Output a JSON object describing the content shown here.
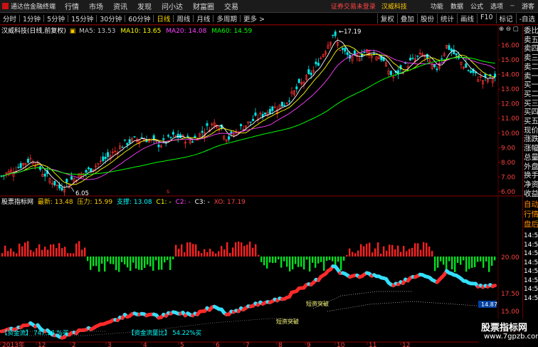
{
  "app": {
    "title": "通达信金融终端",
    "warning": "证券交易未登录",
    "stock_name": "汉威科技"
  },
  "menu": [
    "行情",
    "市场",
    "资讯",
    "发现",
    "问小达",
    "财富圈",
    "交易"
  ],
  "right_menu": [
    "功能",
    "数据",
    "公式",
    "选项"
  ],
  "guest": "游客",
  "periods": [
    "分时",
    "1分钟",
    "5分钟",
    "15分钟",
    "30分钟",
    "60分钟",
    "日线",
    "周线",
    "月线",
    "多周期",
    "更多 >"
  ],
  "active_period": "日线",
  "toolbar_right": [
    "复权",
    "叠加",
    "股份",
    "统计",
    "画线",
    "F10",
    "标记",
    "-自选"
  ],
  "chart_title": "汉威科技(日线,前复权)",
  "ma": {
    "ma5": {
      "label": "MA5: 13.53",
      "color": "#ffffff"
    },
    "ma10": {
      "label": "MA10: 13.65",
      "color": "#ffff00"
    },
    "ma20": {
      "label": "MA20: 14.08",
      "color": "#ff40ff"
    },
    "ma60": {
      "label": "MA60: 14.59",
      "color": "#00ff00"
    }
  },
  "price_axis": [
    "16.00",
    "15.00",
    "14.00",
    "13.00",
    "12.00",
    "11.00",
    "10.00",
    "9.00",
    "8.00",
    "7.00",
    "6.00"
  ],
  "annotations": {
    "high": "17.19",
    "low": "6.05"
  },
  "indicator": {
    "name": "股票指标网",
    "latest": "最新: 13.48",
    "pressure": "压力: 15.99",
    "support": "支撑: 13.08",
    "c1": "C1: -",
    "c2": "C2: -",
    "c3": "C3: -",
    "xo": "XO: 17.19",
    "axis": [
      "20.00",
      "17.50",
      "15.00",
      "12.50"
    ],
    "price_tag": "14.87",
    "label_fund_a": "【资金流】 747.16 %买",
    "label_fund_b": "【资金流量比】 54.22%买",
    "label_short": "短资突破"
  },
  "date_axis": [
    "2013年",
    "12",
    "2",
    "3",
    "4",
    "5",
    "6",
    "7",
    "8",
    "9",
    "10",
    "11",
    "12"
  ],
  "right_panel": [
    "委比",
    "卖五",
    "卖四",
    "卖三",
    "卖二",
    "卖一",
    "买一",
    "买二",
    "买三",
    "买四",
    "买五",
    "现价",
    "涨跌",
    "涨幅",
    "总量",
    "外盘",
    "换手",
    "净资",
    "收益",
    "自动",
    "行情",
    "盘后",
    "14:50",
    "14:50",
    "14:50",
    "14:50",
    "14:50",
    "14:50",
    "14:50",
    "14:50"
  ],
  "watermark": {
    "cn": "股票指标网",
    "url": "www.7gpzb.com"
  }
}
